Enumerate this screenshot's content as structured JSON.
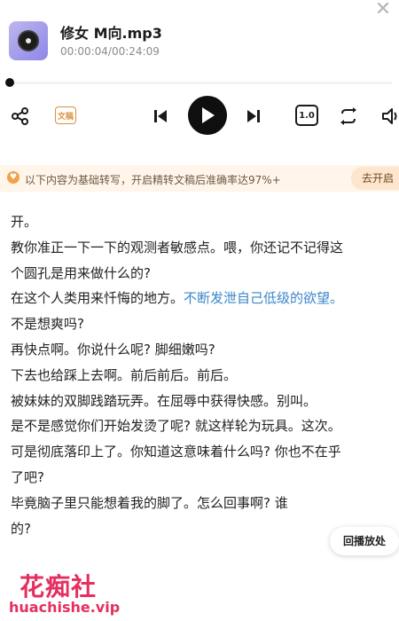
{
  "header": {
    "title": "修女 M向.mp3",
    "time": "00:00:04/00:24:09",
    "close_icon": "close-icon"
  },
  "progress": {
    "fraction": 0.0028
  },
  "controls": {
    "share_icon": "share-icon",
    "transcript_badge": "文稿",
    "previous_icon": "skip-previous-icon",
    "play_icon": "play-icon",
    "next_icon": "skip-next-icon",
    "speed_label": "1.0",
    "loop_icon": "loop-icon",
    "volume_icon": "volume-icon"
  },
  "banner": {
    "text": "以下内容为基础转写，开启精转文稿后准确率达97%+",
    "button": "去开启"
  },
  "transcript": {
    "lines": [
      "开。",
      "教你准正一下一下的观测者敏感点。喂，你还记不记得这",
      "个圆孔是用来做什么的?",
      "在这个人类用来忏悔的地方。",
      "不是想爽吗?",
      "再快点啊。你说什么呢? 脚细嫩吗?",
      "下去也给踩上去啊。前后前后。前后。",
      "被妹妹的双脚践踏玩弄。在屈辱中获得快感。别叫。",
      "是不是感觉你们开始发烫了呢? 就这样轮为玩具。这次。",
      "可是彻底落印上了。你知道这意味着什么吗? 你也不在乎",
      "了吧?",
      "毕竟脑子里只能想着我的脚了。怎么回事啊? 谁",
      "的?"
    ],
    "highlight": "不断发泄自己低级的欲望。"
  },
  "replay_button": "回播放处",
  "watermark": {
    "cn": "花痴社",
    "url": "huachishe.vip"
  },
  "colors": {
    "accent_orange": "#d9913f",
    "banner_bg": "#fff5ea",
    "highlight_blue": "#3a86c9",
    "watermark_pink": "#e52f5f"
  }
}
